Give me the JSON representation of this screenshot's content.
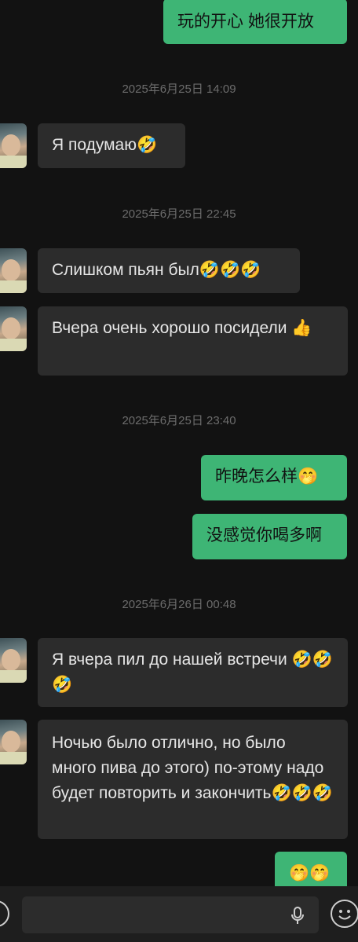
{
  "messages": {
    "m1": "玩的开心  她很开放",
    "t1": "2025年6月25日 14:09",
    "m2": "Я подумаю🤣",
    "t2": "2025年6月25日 22:45",
    "m3": "Слишком пьян был🤣🤣🤣",
    "m4": "Вчера очень хорошо посидели 👍",
    "t3": "2025年6月25日 23:40",
    "m5": "昨晚怎么样🤭",
    "m6": "没感觉你喝多啊",
    "t4": "2025年6月26日 00:48",
    "m7": "Я вчера пил до нашей встречи 🤣🤣🤣",
    "m8": "Ночью было отлично, но было много пива до этого) по-этому надо будет повторить и закончить🤣🤣🤣",
    "m9": "🤭🤭"
  },
  "input_bar": {
    "text_value": "",
    "icons": [
      "voice-icon",
      "microphone-icon",
      "emoji-icon"
    ]
  },
  "colors": {
    "background": "#121212",
    "incoming_bubble": "#2c2c2c",
    "outgoing_bubble": "#3eb575",
    "timestamp": "#6c6c6c"
  }
}
